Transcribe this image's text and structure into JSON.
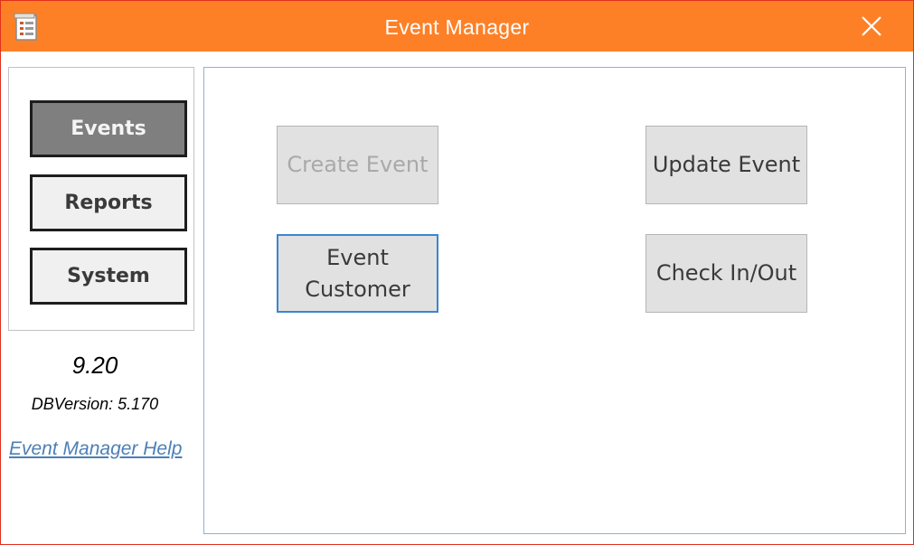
{
  "window": {
    "title": "Event Manager",
    "accent_color": "#fd8027",
    "icons": {
      "app": "form-document-icon",
      "close": "close-icon"
    }
  },
  "sidebar": {
    "nav": [
      {
        "label": "Events",
        "active": true
      },
      {
        "label": "Reports",
        "active": false
      },
      {
        "label": "System",
        "active": false
      }
    ],
    "version": "9.20",
    "db_version": "DBVersion: 5.170",
    "help_link": "Event Manager Help"
  },
  "main": {
    "buttons": {
      "create_event": {
        "label": "Create Event",
        "enabled": false
      },
      "update_event": {
        "label": "Update Event",
        "enabled": true
      },
      "event_customer": {
        "label": "Event Customer",
        "enabled": true,
        "focused": true
      },
      "check_in_out": {
        "label": "Check In/Out",
        "enabled": true
      }
    }
  }
}
